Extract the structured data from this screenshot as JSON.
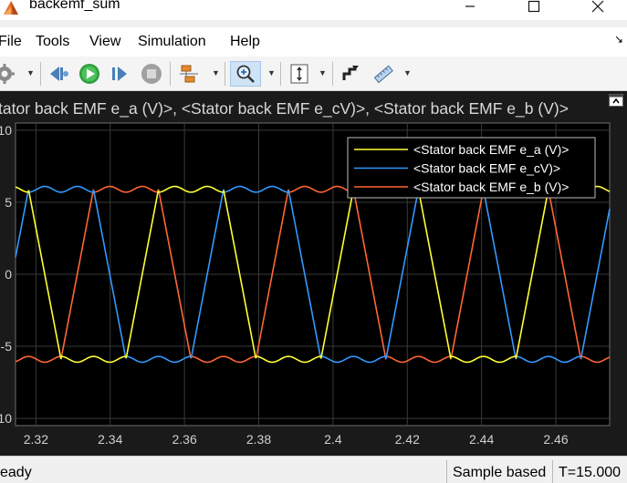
{
  "window": {
    "title": "backemf_sum"
  },
  "menu": {
    "items": [
      "File",
      "Tools",
      "View",
      "Simulation",
      "Help"
    ]
  },
  "toolbar": {
    "buttons": [
      "settings-icon",
      "step-back-icon",
      "run-icon",
      "step-forward-icon",
      "stop-icon",
      "signal-tools-icon",
      "zoom-in-icon",
      "autoscale-icon",
      "style-icon",
      "measurement-icon"
    ]
  },
  "plot": {
    "title": "tator back EMF e_a (V)>, <Stator back EMF e_cV)>, <Stator back EMF e_b (V)>"
  },
  "chart_data": {
    "type": "line",
    "background": "#000000",
    "grid": true,
    "legend_position": "top-right",
    "xlim": [
      2.3145,
      2.4745
    ],
    "ylim": [
      -10.5,
      10.5
    ],
    "x_ticks": [
      "2.32",
      "2.34",
      "2.36",
      "2.38",
      "2.4",
      "2.42",
      "2.44",
      "2.46"
    ],
    "x_tick_values": [
      2.32,
      2.34,
      2.36,
      2.38,
      2.4,
      2.42,
      2.44,
      2.46
    ],
    "y_ticks": [
      "10",
      "5",
      "0",
      "-5",
      "-10"
    ],
    "y_tick_values": [
      10,
      5,
      0,
      -5,
      -10
    ],
    "electrical_period": 0.0525,
    "amplitude": 5.9,
    "ripple": 0.2,
    "series": [
      {
        "name": "<Stator back EMF e_a (V)>",
        "color": "#ffff33",
        "peak_time": 2.318
      },
      {
        "name": "<Stator back EMF e_cV)>",
        "color": "#3399ff",
        "peak_time": 2.3355
      },
      {
        "name": "<Stator back EMF e_b (V)>",
        "color": "#ff6633",
        "peak_time": 2.353
      }
    ]
  },
  "status": {
    "text": "eady",
    "mode": "Sample based",
    "time": "T=15.000"
  }
}
